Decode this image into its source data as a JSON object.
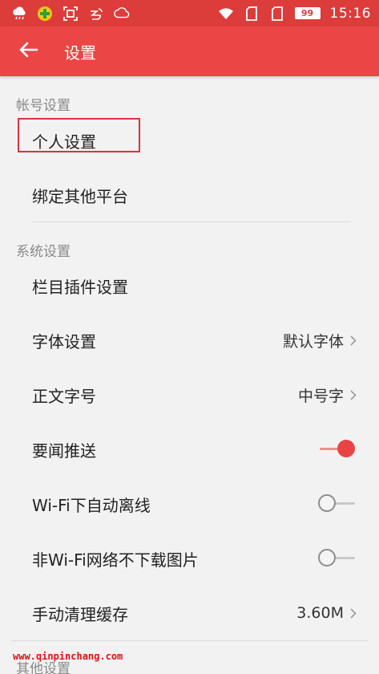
{
  "status_bar": {
    "icons": [
      "cloud-rain-icon",
      "shield-plus-icon",
      "scan-icon",
      "weibo-icon",
      "chat-bubble-icon"
    ],
    "battery": "99",
    "time": "15:16"
  },
  "app_bar": {
    "back_icon": "arrow-left-icon",
    "title": "设置"
  },
  "sections": {
    "account": {
      "header": "帐号设置",
      "items": {
        "personal": "个人设置",
        "bind_platforms": "绑定其他平台"
      }
    },
    "system": {
      "header": "系统设置",
      "items": {
        "column_plugins": "栏目插件设置",
        "font": {
          "label": "字体设置",
          "value": "默认字体"
        },
        "text_size": {
          "label": "正文字号",
          "value": "中号字"
        },
        "news_push": {
          "label": "要闻推送",
          "enabled": true
        },
        "wifi_offline": {
          "label": "Wi-Fi下自动离线",
          "enabled": false
        },
        "no_image_non_wifi": {
          "label": "非Wi-Fi网络不下载图片",
          "enabled": false
        },
        "clear_cache": {
          "label": "手动清理缓存",
          "value": "3.60M"
        }
      }
    },
    "other": {
      "header": "其他设置"
    }
  },
  "watermark": "www.qinpinchang.com",
  "colors": {
    "status_bar": "#dc3c3a",
    "app_bar": "#eb4545",
    "accent": "#e94444",
    "highlight_box": "#d9343a"
  }
}
